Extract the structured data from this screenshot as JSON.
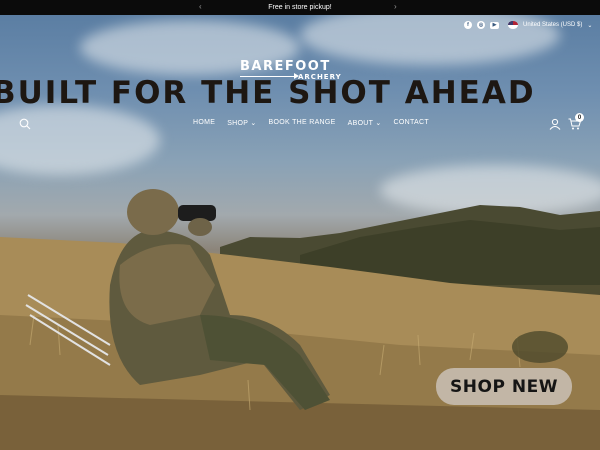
{
  "announcement": {
    "text": "Free in store pickup!",
    "prev_icon": "chevron-left",
    "next_icon": "chevron-right"
  },
  "utilities": {
    "socials": [
      "facebook",
      "instagram",
      "youtube"
    ],
    "currency": "United States (USD $)"
  },
  "logo": {
    "line1": "BAREFOOT",
    "line2": "ARCHERY"
  },
  "hero": {
    "headline": "BUILT FOR THE SHOT AHEAD",
    "cta_label": "SHOP NEW"
  },
  "nav": {
    "items": [
      "HOME",
      "SHOP ⌄",
      "BOOK THE RANGE",
      "ABOUT ⌄",
      "CONTACT"
    ],
    "cart_count": "0"
  },
  "colors": {
    "announcement_bg": "#0b0b0b",
    "cta_bg": "#c2b6a6",
    "headline": "#1d1712"
  }
}
